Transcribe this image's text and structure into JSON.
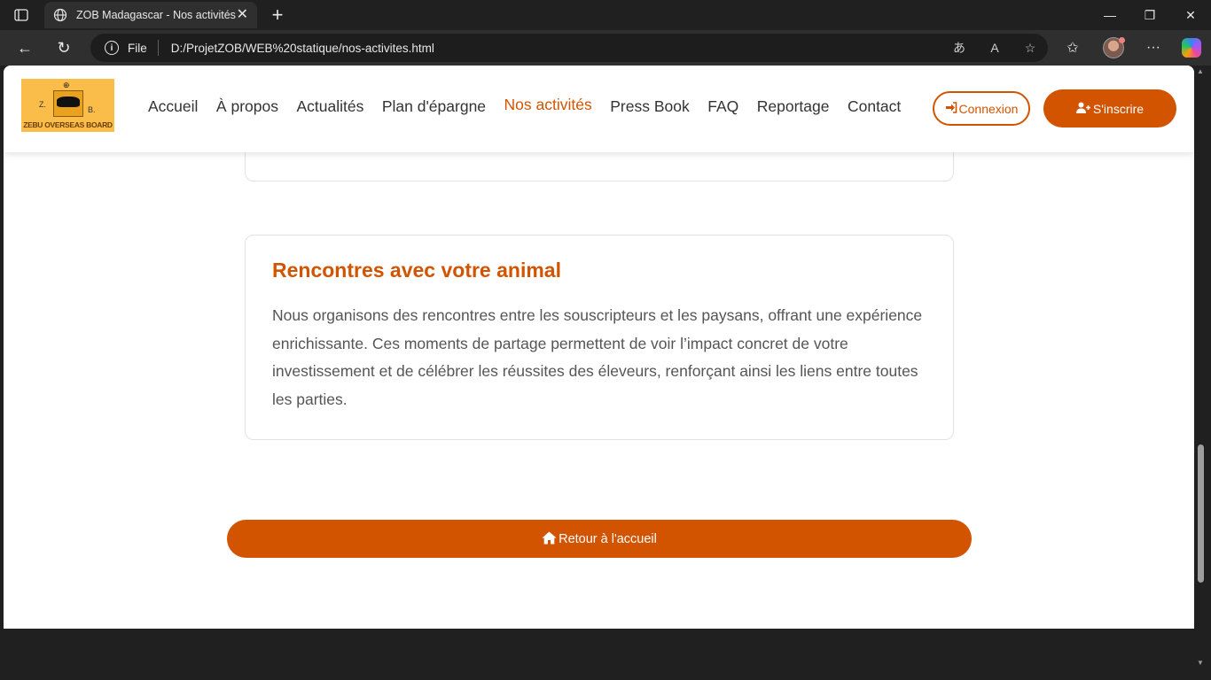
{
  "browser": {
    "tab_title": "ZOB Madagascar - Nos activités",
    "file_label": "File",
    "url": "D:/ProjetZOB/WEB%20statique/nos-activites.html"
  },
  "site": {
    "logo_text": "ZEBU OVERSEAS BOARD",
    "logo_letters": {
      "left": "Z.",
      "right": "B."
    },
    "nav": [
      {
        "label": "Accueil",
        "active": false
      },
      {
        "label": "À propos",
        "active": false
      },
      {
        "label": "Actualités",
        "active": false
      },
      {
        "label": "Plan d'épargne",
        "active": false
      },
      {
        "label": "Nos activités",
        "active": true
      },
      {
        "label": "Press Book",
        "active": false
      },
      {
        "label": "FAQ",
        "active": false
      },
      {
        "label": "Reportage",
        "active": false
      },
      {
        "label": "Contact",
        "active": false
      }
    ],
    "login_label": "Connexion",
    "signup_label": "S'inscrire"
  },
  "content": {
    "card": {
      "title": "Rencontres avec votre animal",
      "text": "Nous organisons des rencontres entre les souscripteurs et les paysans, offrant une expérience enrichissante. Ces moments de partage permettent de voir l’impact concret de votre investissement et de célébrer les réussites des éleveurs, renforçant ainsi les liens entre toutes les parties."
    },
    "home_button": "Retour à l'accueil"
  },
  "colors": {
    "accent": "#d35400",
    "chrome": "#202020"
  }
}
